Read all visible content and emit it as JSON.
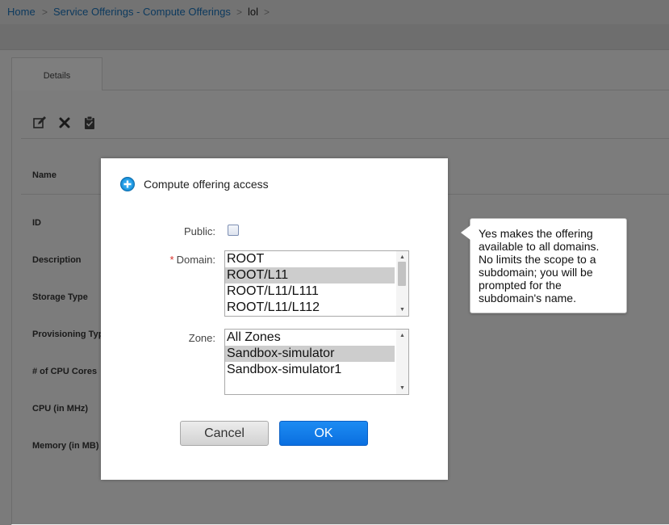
{
  "breadcrumb": {
    "items": [
      "Home",
      "Service Offerings - Compute Offerings",
      "lol"
    ],
    "separator": ">"
  },
  "details": {
    "tab_label": "Details",
    "actions": {
      "edit_icon": "edit-icon",
      "delete_icon": "close-icon",
      "access_icon": "clipboard-icon"
    },
    "fields": [
      "Name",
      "ID",
      "Description",
      "Storage Type",
      "Provisioning Typ",
      "# of CPU Cores",
      "CPU (in MHz)",
      "Memory (in MB)"
    ]
  },
  "dialog": {
    "title": "Compute offering access",
    "title_icon": "plus-circle-icon",
    "public_label": "Public:",
    "public_checked": false,
    "domain_required_mark": "*",
    "domain_label": "Domain:",
    "domain_options": [
      "ROOT",
      "ROOT/L11",
      "ROOT/L11/L111",
      "ROOT/L11/L112"
    ],
    "domain_selected": "ROOT/L11",
    "zone_label": "Zone:",
    "zone_options": [
      "All Zones",
      "Sandbox-simulator",
      "Sandbox-simulator1"
    ],
    "zone_selected": "Sandbox-simulator",
    "cancel_label": "Cancel",
    "ok_label": "OK"
  },
  "tooltip": {
    "lines": [
      "Yes makes the offering",
      "available to all domains.",
      "No limits the scope to a",
      "subdomain; you will be",
      "prompted for the",
      "subdomain's name."
    ]
  },
  "colors": {
    "link": "#1a6fb5",
    "ok_button": "#0a6fe0",
    "required": "#d8312b",
    "selection": "#cdcdcd"
  }
}
